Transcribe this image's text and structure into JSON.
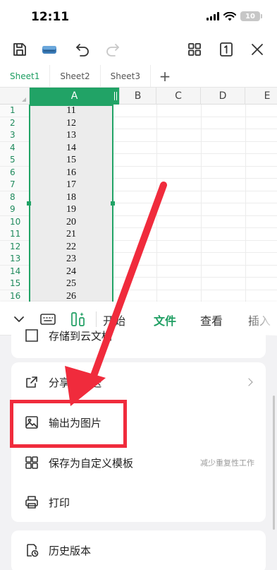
{
  "status": {
    "time": "12:11",
    "battery": "10"
  },
  "toolbar": {
    "buttons": [
      "save-icon",
      "cloud-icon",
      "undo-icon",
      "redo-icon",
      "grid-view-icon",
      "single-page-icon",
      "close-icon"
    ]
  },
  "sheets": {
    "tabs": [
      "Sheet1",
      "Sheet2",
      "Sheet3"
    ],
    "active": 0,
    "add": "+"
  },
  "grid": {
    "columns": [
      "A",
      "B",
      "C",
      "D",
      "E"
    ],
    "rows": [
      {
        "n": "1",
        "a": "11"
      },
      {
        "n": "2",
        "a": "12"
      },
      {
        "n": "3",
        "a": "13"
      },
      {
        "n": "4",
        "a": "14"
      },
      {
        "n": "5",
        "a": "15"
      },
      {
        "n": "6",
        "a": "16"
      },
      {
        "n": "7",
        "a": "17"
      },
      {
        "n": "8",
        "a": "18"
      },
      {
        "n": "9",
        "a": "19"
      },
      {
        "n": "10",
        "a": "20"
      },
      {
        "n": "11",
        "a": "21"
      },
      {
        "n": "12",
        "a": "22"
      },
      {
        "n": "13",
        "a": "23"
      },
      {
        "n": "14",
        "a": "24"
      },
      {
        "n": "15",
        "a": "25"
      },
      {
        "n": "16",
        "a": "26"
      }
    ],
    "selected_column": "A"
  },
  "ribbon": {
    "tabs": [
      "开始",
      "文件",
      "查看",
      "插入"
    ],
    "active_tab": "文件",
    "accent": "#1e9e62"
  },
  "menu": {
    "partial_top": "存储到云文档",
    "items": [
      {
        "label": "分享与发送",
        "icon": "share-icon",
        "hint": "",
        "chevron": true
      },
      {
        "label": "输出为图片",
        "icon": "image-icon",
        "hint": "",
        "chevron": false
      },
      {
        "label": "保存为自定义模板",
        "icon": "template-icon",
        "hint": "减少重复性工作",
        "chevron": false
      },
      {
        "label": "打印",
        "icon": "print-icon",
        "hint": "",
        "chevron": false
      }
    ],
    "history": {
      "label": "历史版本",
      "icon": "history-icon"
    }
  },
  "annotation": {
    "color": "#f02b3c"
  }
}
